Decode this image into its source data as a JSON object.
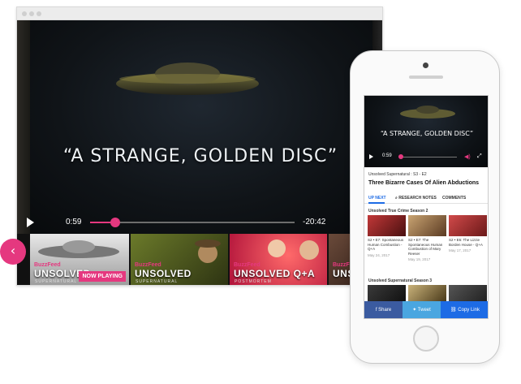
{
  "video": {
    "caption": "“A STRANGE, GOLDEN DISC”",
    "current_time": "0:59",
    "remaining_time": "-20:42",
    "progress": 0.1
  },
  "strip": {
    "tiles": [
      {
        "brand": "BuzzFeed",
        "show": "UNSOLVED",
        "subtitle": "SUPERNATURAL",
        "badge": "NOW PLAYING"
      },
      {
        "brand": "BuzzFeed",
        "show": "UNSOLVED",
        "subtitle": "SUPERNATURAL"
      },
      {
        "brand": "BuzzFeed",
        "show": "UNSOLVED Q+A",
        "subtitle": "POSTMORTEM"
      },
      {
        "brand": "BuzzFeed",
        "show": "UNSO",
        "subtitle": ""
      }
    ],
    "prev_icon": "‹"
  },
  "phone": {
    "caption": "“A STRANGE, GOLDEN DISC”",
    "current_time": "0:59",
    "series": "Unsolved Supernatural : S3 - E2",
    "title": "Three Bizarre Cases Of Alien Abductions",
    "tabs": [
      "UP NEXT",
      "RESEARCH NOTES",
      "COMMENTS"
    ],
    "section1": "Unsolved True Crime Season 2",
    "cards": [
      {
        "text": "S2 • E7: Spontaneous Human Combustion - Q+A",
        "date": "May 24, 2017"
      },
      {
        "text": "S2 • E7: The Spontaneous Human Combustion of Mary Reeser",
        "date": "May 19, 2017"
      },
      {
        "text": "S2 • E6: The Lizzie Borden House - Q+A",
        "date": "May 17, 2017"
      }
    ],
    "section2": "Unsolved Supernatural Season 3",
    "share": {
      "facebook": "Share",
      "twitter": "Tweet",
      "link": "Copy Link"
    }
  },
  "colors": {
    "accent": "#e5387f",
    "blue": "#1d6be5",
    "facebook": "#3b5ba0",
    "twitter": "#4aa6e0"
  }
}
